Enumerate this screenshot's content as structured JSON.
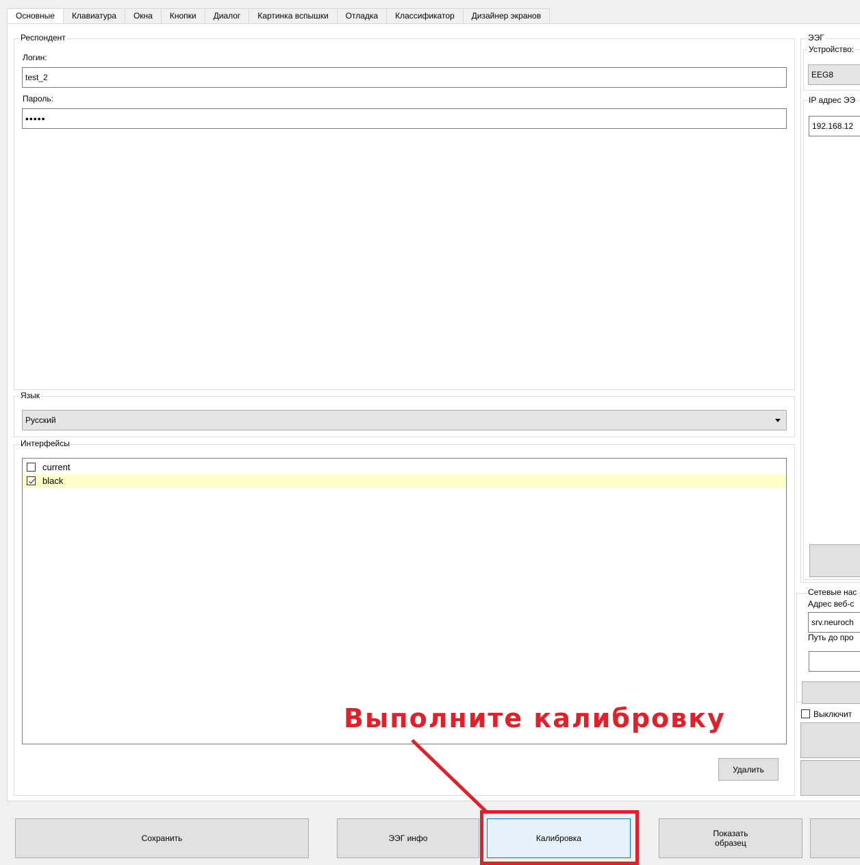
{
  "tabs": [
    "Основные",
    "Клавиатура",
    "Окна",
    "Кнопки",
    "Диалог",
    "Картинка вспышки",
    "Отладка",
    "Классификатор",
    "Дизайнер экранов"
  ],
  "respondent": {
    "legend": "Респондент",
    "login_label": "Логин:",
    "login_value": "test_2",
    "password_label": "Пароль:",
    "password_value": "•••••"
  },
  "language": {
    "legend": "Язык",
    "selected": "Русский"
  },
  "interfaces": {
    "legend": "Интерфейсы",
    "items": [
      {
        "label": "current",
        "checked": false
      },
      {
        "label": "black",
        "checked": true
      }
    ],
    "delete_button": "Удалить"
  },
  "eeg": {
    "legend": "ЭЭГ",
    "device_label": "Устройство:",
    "device_value": "EEG8",
    "ip_label": "IP адрес ЭЭ",
    "ip_value": "192.168.12"
  },
  "network": {
    "legend": "Сетевые нас",
    "web_label": "Адрес веб-с",
    "web_value": "srv.neuroch",
    "path_label": "Путь до про",
    "path_value": "",
    "disable_checkbox": "Выключит"
  },
  "footer": {
    "save": "Сохранить",
    "eeg_info": "ЭЭГ инфо",
    "calibration": "Калибровка",
    "show_sample": "Показать образец"
  },
  "annotation": {
    "text": "Выполните калибровку",
    "color": "#e0202a"
  }
}
